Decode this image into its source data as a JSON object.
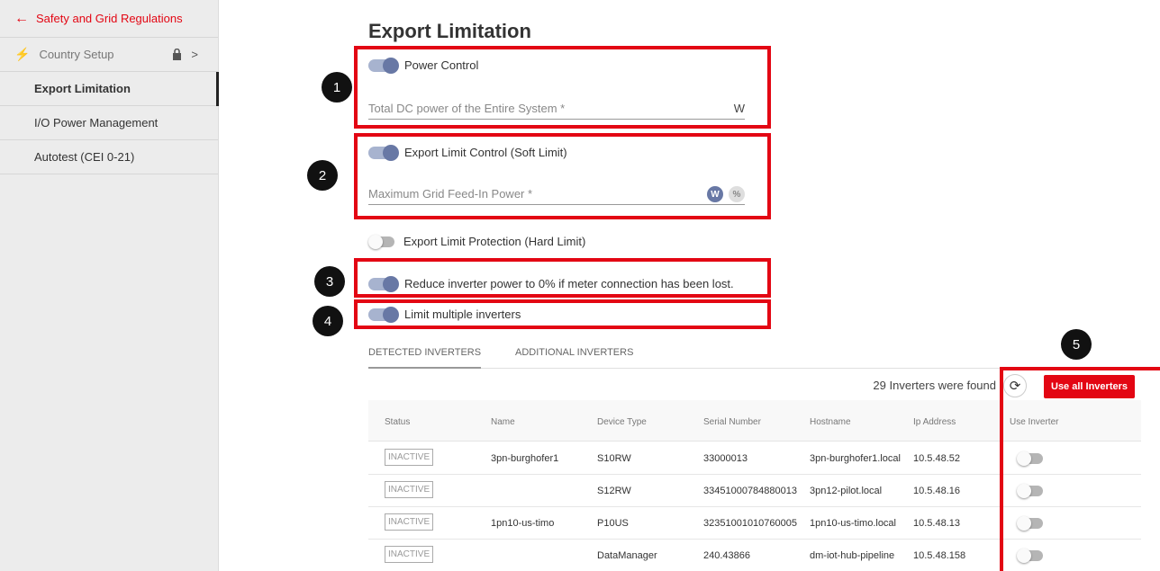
{
  "sidebar": {
    "back_label": "Safety and Grid Regulations",
    "items": [
      {
        "label": "Country Setup"
      },
      {
        "label": "Export Limitation"
      },
      {
        "label": "I/O Power Management"
      },
      {
        "label": "Autotest (CEI 0-21)"
      }
    ]
  },
  "page": {
    "title": "Export Limitation"
  },
  "power_control": {
    "label": "Power Control",
    "field_placeholder": "Total DC power of the Entire System *",
    "unit": "W"
  },
  "export_soft": {
    "label": "Export Limit Control (Soft Limit)",
    "field_placeholder": "Maximum Grid Feed-In Power *",
    "unit_w": "W",
    "unit_pct": "%"
  },
  "export_hard": {
    "label": "Export Limit Protection (Hard Limit)"
  },
  "reduce_power": {
    "label": "Reduce inverter power to 0% if meter connection has been lost."
  },
  "multiple": {
    "label": "Limit multiple inverters"
  },
  "badges": [
    "1",
    "2",
    "3",
    "4",
    "5"
  ],
  "tabs": [
    "DETECTED INVERTERS",
    "ADDITIONAL INVERTERS"
  ],
  "found_text": "29 Inverters were found",
  "use_all_button": "Use all Inverters",
  "table": {
    "headers": [
      "Status",
      "Name",
      "Device Type",
      "Serial Number",
      "Hostname",
      "Ip Address",
      "Use Inverter"
    ],
    "rows": [
      {
        "status": "INACTIVE",
        "name": "3pn-burghofer1",
        "type": "S10RW",
        "serial": "33000013",
        "host": "3pn-burghofer1.local",
        "ip": "10.5.48.52"
      },
      {
        "status": "INACTIVE",
        "name": "",
        "type": "S12RW",
        "serial": "33451000784880013",
        "host": "3pn12-pilot.local",
        "ip": "10.5.48.16"
      },
      {
        "status": "INACTIVE",
        "name": "1pn10-us-timo",
        "type": "P10US",
        "serial": "32351001010760005",
        "host": "1pn10-us-timo.local",
        "ip": "10.5.48.13"
      },
      {
        "status": "INACTIVE",
        "name": "",
        "type": "DataManager",
        "serial": "240.43866",
        "host": "dm-iot-hub-pipeline",
        "ip": "10.5.48.158"
      }
    ]
  },
  "colors": {
    "accent": "#e30613",
    "toggle_on": "#6878a5"
  }
}
